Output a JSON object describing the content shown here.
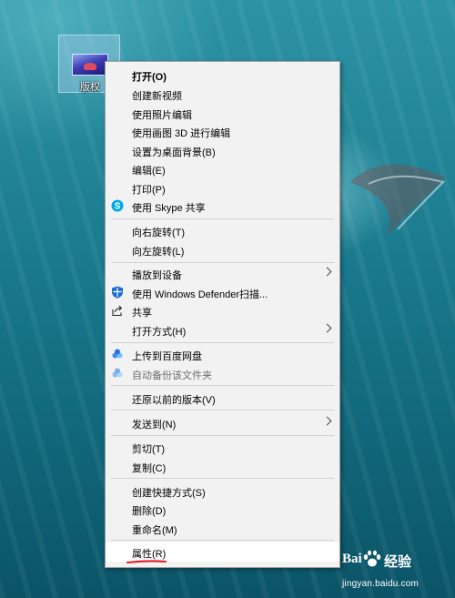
{
  "desktop": {
    "icon": {
      "label": "版权",
      "icon": "image-file-icon"
    }
  },
  "context_menu": {
    "items": [
      {
        "label": "打开(O)",
        "bold": true
      },
      {
        "label": "创建新视频"
      },
      {
        "label": "使用照片编辑"
      },
      {
        "label": "使用画图 3D 进行编辑"
      },
      {
        "label": "设置为桌面背景(B)"
      },
      {
        "label": "编辑(E)"
      },
      {
        "label": "打印(P)"
      },
      {
        "label": "使用 Skype 共享",
        "icon": "skype-icon"
      },
      {
        "label": "向右旋转(T)"
      },
      {
        "label": "向左旋转(L)"
      },
      {
        "label": "播放到设备",
        "submenu": true
      },
      {
        "label": "使用 Windows Defender扫描...",
        "icon": "defender-shield-icon"
      },
      {
        "label": "共享",
        "icon": "share-icon"
      },
      {
        "label": "打开方式(H)",
        "submenu": true
      },
      {
        "label": "上传到百度网盘",
        "icon": "baidu-netdisk-icon"
      },
      {
        "label": "自动备份该文件夹",
        "icon": "baidu-netdisk-icon",
        "disabled": true
      },
      {
        "label": "还原以前的版本(V)"
      },
      {
        "label": "发送到(N)",
        "submenu": true
      },
      {
        "label": "剪切(T)"
      },
      {
        "label": "复制(C)"
      },
      {
        "label": "创建快捷方式(S)"
      },
      {
        "label": "删除(D)"
      },
      {
        "label": "重命名(M)"
      },
      {
        "label": "属性(R)",
        "highlighted": true,
        "annotated": true
      }
    ]
  },
  "annotation": {
    "underline_color": "#e5191f"
  },
  "watermark": {
    "brand_latin": "Bai",
    "brand_cn": "经验",
    "url": "jingyan.baidu.com"
  },
  "colors": {
    "menu_bg": "#f2f2f2",
    "menu_border": "#a0a0a0",
    "separator": "#d2d2d2",
    "highlight": "#ffffff",
    "disabled_text": "#6d6d6d"
  }
}
